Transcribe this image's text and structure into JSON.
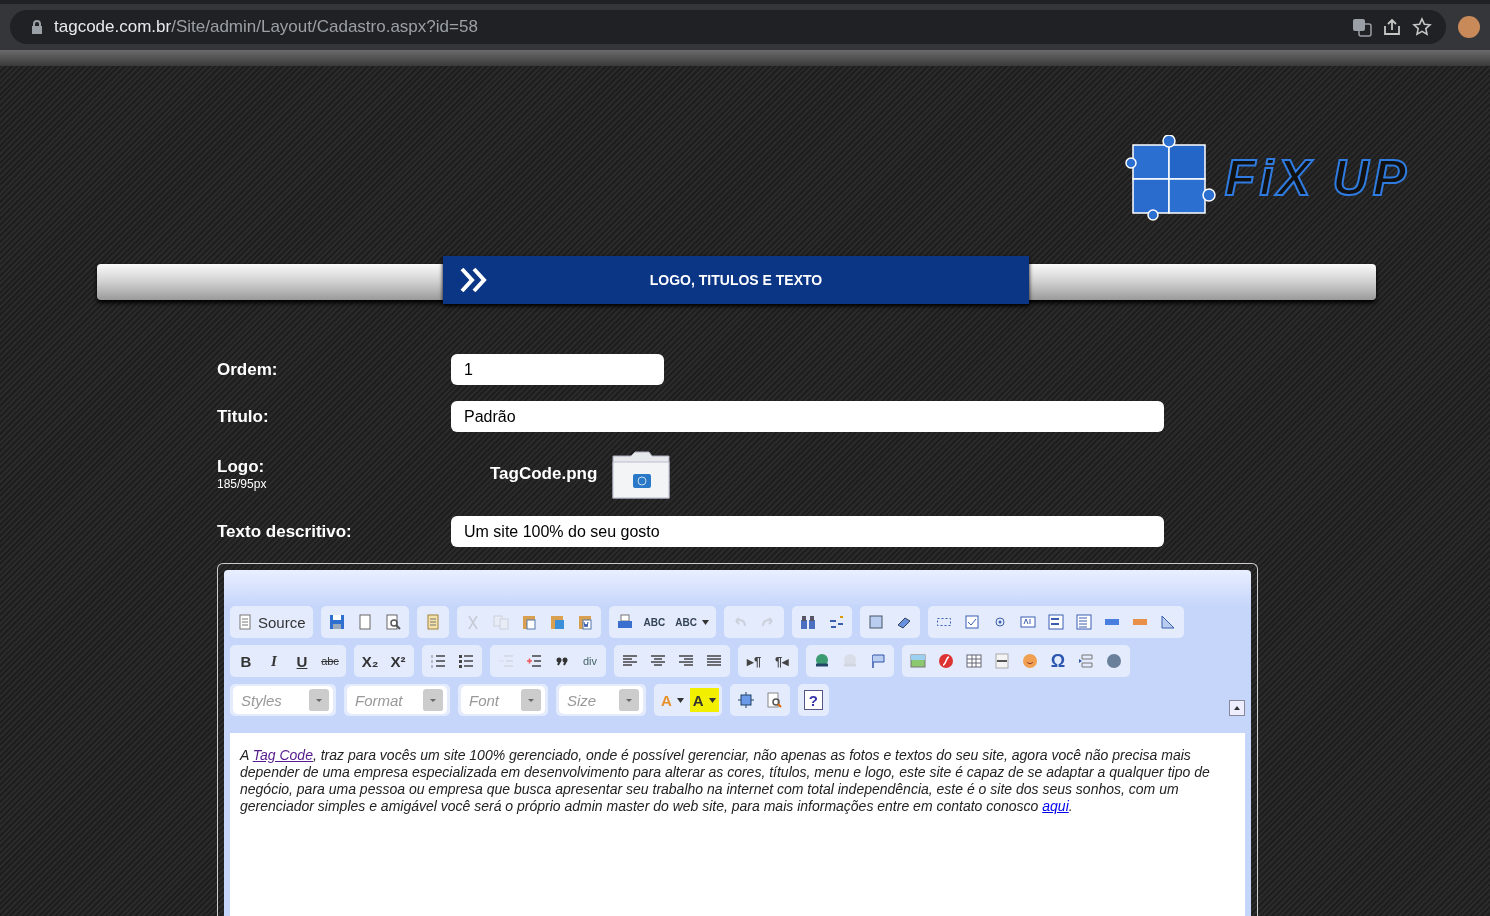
{
  "browser": {
    "host": "tagcode.com.br",
    "path": "/Site/admin/Layout/Cadastro.aspx?id=58"
  },
  "logo": {
    "text": "FiX UP"
  },
  "banner": {
    "title": "LOGO, TITULOS E TEXTO"
  },
  "form": {
    "fields": [
      {
        "kind": "short",
        "label": "Ordem:",
        "value": "1"
      },
      {
        "kind": "long",
        "label": "Titulo:",
        "value": "Padrão"
      },
      {
        "kind": "file",
        "label": "Logo:",
        "hint": "185/95px",
        "value": "TagCode.png"
      },
      {
        "kind": "long",
        "label": "Texto descritivo:",
        "value": "Um site 100% do seu gosto"
      }
    ]
  },
  "editor": {
    "toolbar_rows": [
      {
        "groups": [
          {
            "items": [
              {
                "kind": "source",
                "label": "Source",
                "disabled": false
              }
            ]
          },
          {
            "items": [
              {
                "kind": "save",
                "disabled": false
              },
              {
                "kind": "newpage",
                "disabled": false
              },
              {
                "kind": "preview",
                "disabled": false
              }
            ]
          },
          {
            "items": [
              {
                "kind": "templates",
                "disabled": false
              }
            ]
          },
          {
            "items": [
              {
                "kind": "cut",
                "disabled": true
              },
              {
                "kind": "copy",
                "disabled": true
              },
              {
                "kind": "paste",
                "disabled": false
              },
              {
                "kind": "pastetext",
                "disabled": false
              },
              {
                "kind": "pasteword",
                "disabled": false
              }
            ]
          },
          {
            "items": [
              {
                "kind": "print",
                "disabled": false
              },
              {
                "kind": "spell",
                "glyph": "ABC",
                "disabled": false
              },
              {
                "kind": "spellmenu",
                "glyph": "ABC",
                "disabled": false
              }
            ]
          },
          {
            "items": [
              {
                "kind": "undo",
                "disabled": true
              },
              {
                "kind": "redo",
                "disabled": true
              }
            ]
          },
          {
            "items": [
              {
                "kind": "find",
                "disabled": false
              },
              {
                "kind": "replace",
                "disabled": false
              }
            ]
          },
          {
            "items": [
              {
                "kind": "selectall",
                "disabled": false
              },
              {
                "kind": "eraser",
                "disabled": false
              }
            ]
          },
          {
            "items": [
              {
                "kind": "form",
                "disabled": false
              },
              {
                "kind": "checkbox",
                "disabled": false
              },
              {
                "kind": "radio",
                "disabled": false
              },
              {
                "kind": "textfield",
                "disabled": false
              },
              {
                "kind": "textarea",
                "disabled": false
              },
              {
                "kind": "select",
                "disabled": false
              },
              {
                "kind": "button",
                "disabled": false
              },
              {
                "kind": "imagebutton",
                "disabled": false
              },
              {
                "kind": "hiddenfield",
                "disabled": false
              }
            ]
          }
        ]
      },
      {
        "groups": [
          {
            "items": [
              {
                "kind": "bold",
                "glyph": "B",
                "disabled": false
              },
              {
                "kind": "italic",
                "glyph": "I",
                "disabled": false
              },
              {
                "kind": "underline",
                "glyph": "U",
                "disabled": false
              },
              {
                "kind": "strike",
                "glyph": "abc",
                "disabled": false
              }
            ]
          },
          {
            "items": [
              {
                "kind": "subscript",
                "glyph": "X₂",
                "disabled": false
              },
              {
                "kind": "superscript",
                "glyph": "X²",
                "disabled": false
              }
            ]
          },
          {
            "items": [
              {
                "kind": "numbered",
                "disabled": false
              },
              {
                "kind": "bulleted",
                "disabled": false
              }
            ]
          },
          {
            "items": [
              {
                "kind": "outdent",
                "disabled": true
              },
              {
                "kind": "indent",
                "disabled": false
              },
              {
                "kind": "quote",
                "disabled": false
              },
              {
                "kind": "div",
                "glyph": "div",
                "disabled": false
              }
            ]
          },
          {
            "items": [
              {
                "kind": "alignleft",
                "disabled": false
              },
              {
                "kind": "aligncenter",
                "disabled": false
              },
              {
                "kind": "alignright",
                "disabled": false
              },
              {
                "kind": "justify",
                "disabled": false
              }
            ]
          },
          {
            "items": [
              {
                "kind": "ltr",
                "glyph": "▸¶",
                "disabled": false
              },
              {
                "kind": "rtl",
                "glyph": "¶◂",
                "disabled": false
              }
            ]
          },
          {
            "items": [
              {
                "kind": "link",
                "disabled": false
              },
              {
                "kind": "unlink",
                "disabled": true
              },
              {
                "kind": "anchor",
                "disabled": false
              }
            ]
          },
          {
            "items": [
              {
                "kind": "image",
                "disabled": false
              },
              {
                "kind": "flash",
                "disabled": false
              },
              {
                "kind": "table",
                "disabled": false
              },
              {
                "kind": "rule",
                "disabled": false
              },
              {
                "kind": "smiley",
                "disabled": false
              },
              {
                "kind": "special",
                "glyph": "Ω",
                "disabled": false
              },
              {
                "kind": "pagebreak",
                "disabled": false
              },
              {
                "kind": "globe",
                "disabled": false
              }
            ]
          }
        ]
      },
      {
        "groups": [
          {
            "items": [
              {
                "kind": "combo",
                "placeholder": "Styles"
              }
            ]
          },
          {
            "items": [
              {
                "kind": "combo",
                "placeholder": "Format"
              }
            ]
          },
          {
            "items": [
              {
                "kind": "combo",
                "placeholder": "Font"
              }
            ]
          },
          {
            "items": [
              {
                "kind": "combo",
                "placeholder": "Size"
              }
            ]
          },
          {
            "items": [
              {
                "kind": "textcolor",
                "glyph": "A",
                "disabled": false
              },
              {
                "kind": "bgcolor",
                "glyph": "A",
                "disabled": false
              }
            ]
          },
          {
            "items": [
              {
                "kind": "maximize",
                "disabled": false
              },
              {
                "kind": "showblocks",
                "disabled": false
              }
            ]
          },
          {
            "items": [
              {
                "kind": "about",
                "glyph": "?",
                "disabled": false
              }
            ]
          }
        ]
      }
    ],
    "content": [
      {
        "kind": "text",
        "text": "A "
      },
      {
        "kind": "link",
        "text": "Tag Code",
        "visited": true
      },
      {
        "kind": "text",
        "text": ", traz para vocês um site 100% gerenciado, onde é possível gerenciar, não apenas as fotos e textos do seu site, agora você não precisa mais depender de uma empresa especializada em desenvolvimento para alterar as cores, títulos, menu e logo, este site é capaz de se adaptar a qualquer tipo de negócio, para uma pessoa ou empresa que busca apresentar seu trabalho na internet com total independência, este é o site dos seus sonhos, com um gerenciador simples e amigável você será o próprio admin master do web site, para mais informações entre em contato conosco "
      },
      {
        "kind": "link",
        "text": "aqui",
        "visited": false
      },
      {
        "kind": "text",
        "text": "."
      }
    ]
  }
}
